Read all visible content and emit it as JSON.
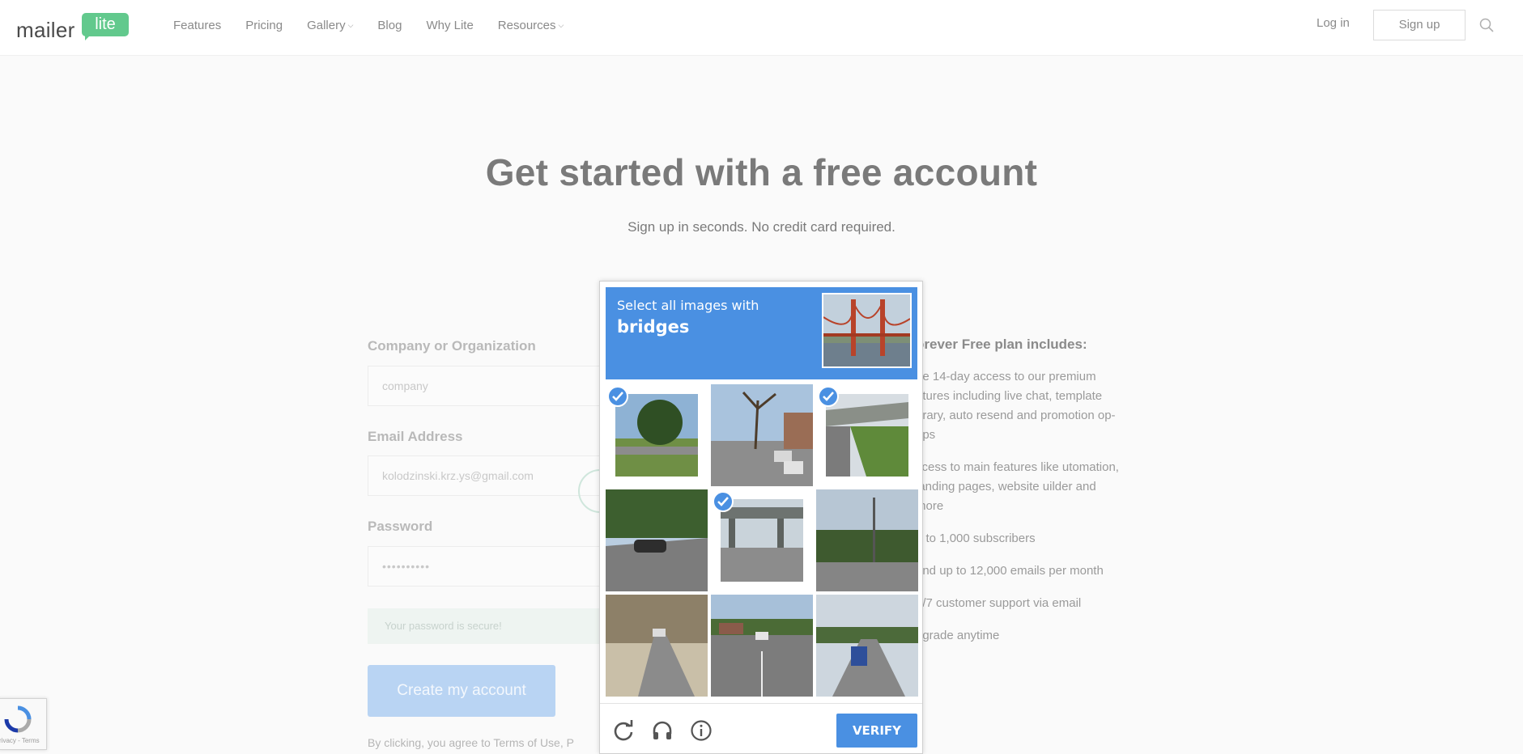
{
  "header": {
    "logo_main": "mailer",
    "logo_badge": "lite",
    "nav": [
      {
        "label": "Features",
        "dropdown": false
      },
      {
        "label": "Pricing",
        "dropdown": false
      },
      {
        "label": "Gallery",
        "dropdown": true
      },
      {
        "label": "Blog",
        "dropdown": false
      },
      {
        "label": "Why Lite",
        "dropdown": false
      },
      {
        "label": "Resources",
        "dropdown": true
      }
    ],
    "login": "Log in",
    "signup": "Sign up",
    "search_icon": "search-icon"
  },
  "hero": {
    "title": "Get started with a free account",
    "subtitle": "Sign up in seconds. No credit card required."
  },
  "form": {
    "company_label": "Company or Organization",
    "company_placeholder": "company",
    "email_label": "Email Address",
    "email_value": "kolodzinski.krz.ys@gmail.com",
    "password_label": "Password",
    "password_value": "••••••••••",
    "secure_note": "Your password is secure!",
    "create_button": "Create my account",
    "terms": "By clicking, you agree to Terms of Use, P"
  },
  "plan": {
    "title": "orever Free plan includes:",
    "items": [
      "ee 14-day access to our premium atures including live chat, template orary, auto resend and promotion op-ups",
      "ccess to main features like utomation, landing pages, website uilder and more",
      "p to 1,000 subscribers",
      "end up to 12,000 emails per month",
      "4/7 customer support via email",
      "pgrade anytime"
    ]
  },
  "captcha": {
    "prompt": "Select all images with",
    "target": "bridges",
    "verify": "VERIFY",
    "tiles_selected": [
      true,
      false,
      true,
      false,
      true,
      false,
      false,
      false,
      false
    ],
    "footer_icons": [
      "refresh-icon",
      "headphones-icon",
      "info-icon"
    ],
    "accent": "#4a90e2"
  },
  "recaptcha_badge": {
    "text": "rivacy - Terms"
  }
}
